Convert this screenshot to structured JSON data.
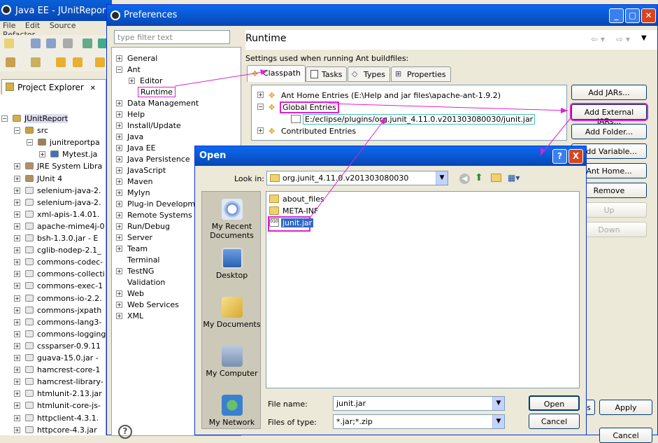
{
  "eclipse": {
    "title": "Java EE - JUnitReport",
    "menu": [
      "File",
      "Edit",
      "Source",
      "Refactor"
    ],
    "project_explorer": {
      "tab_label": "Project Explorer",
      "items": [
        {
          "label": "JUnitReport",
          "depth": 0,
          "icon": "project-icon"
        },
        {
          "label": "src",
          "depth": 1,
          "icon": "source-folder-icon"
        },
        {
          "label": "junitreportpa",
          "depth": 2,
          "icon": "package-icon"
        },
        {
          "label": "Mytest.ja",
          "depth": 3,
          "icon": "java-file-icon"
        },
        {
          "label": "JRE System Libra",
          "depth": 1,
          "icon": "library-icon"
        },
        {
          "label": "JUnit 4",
          "depth": 1,
          "icon": "library-icon"
        },
        {
          "label": "selenium-java-2.",
          "depth": 1,
          "icon": "jar-icon"
        },
        {
          "label": "selenium-java-2.",
          "depth": 1,
          "icon": "jar-icon"
        },
        {
          "label": "xml-apis-1.4.01.",
          "depth": 1,
          "icon": "jar-icon"
        },
        {
          "label": "apache-mime4j-0",
          "depth": 1,
          "icon": "jar-icon"
        },
        {
          "label": "bsh-1.3.0.jar - E",
          "depth": 1,
          "icon": "jar-icon"
        },
        {
          "label": "cglib-nodep-2.1_",
          "depth": 1,
          "icon": "jar-icon"
        },
        {
          "label": "commons-codec-",
          "depth": 1,
          "icon": "jar-icon"
        },
        {
          "label": "commons-collecti",
          "depth": 1,
          "icon": "jar-icon"
        },
        {
          "label": "commons-exec-1",
          "depth": 1,
          "icon": "jar-icon"
        },
        {
          "label": "commons-io-2.2.",
          "depth": 1,
          "icon": "jar-icon"
        },
        {
          "label": "commons-jxpath",
          "depth": 1,
          "icon": "jar-icon"
        },
        {
          "label": "commons-lang3-",
          "depth": 1,
          "icon": "jar-icon"
        },
        {
          "label": "commons-logging",
          "depth": 1,
          "icon": "jar-icon"
        },
        {
          "label": "cssparser-0.9.11",
          "depth": 1,
          "icon": "jar-icon"
        },
        {
          "label": "guava-15.0.jar -",
          "depth": 1,
          "icon": "jar-icon"
        },
        {
          "label": "hamcrest-core-1",
          "depth": 1,
          "icon": "jar-icon"
        },
        {
          "label": "hamcrest-library-",
          "depth": 1,
          "icon": "jar-icon"
        },
        {
          "label": "htmlunit-2.13.jar",
          "depth": 1,
          "icon": "jar-icon"
        },
        {
          "label": "htmlunit-core-js-",
          "depth": 1,
          "icon": "jar-icon"
        },
        {
          "label": "httpclient-4.3.1.",
          "depth": 1,
          "icon": "jar-icon"
        },
        {
          "label": "httpcore-4.3.jar",
          "depth": 1,
          "icon": "jar-icon"
        }
      ]
    }
  },
  "preferences": {
    "title": "Preferences",
    "filter_placeholder": "type filter text",
    "tree": [
      {
        "label": "General",
        "depth": 0,
        "expander": "+"
      },
      {
        "label": "Ant",
        "depth": 0,
        "expander": "-"
      },
      {
        "label": "Editor",
        "depth": 1,
        "expander": "+"
      },
      {
        "label": "Runtime",
        "depth": 1,
        "expander": "",
        "selected": true
      },
      {
        "label": "Data Management",
        "depth": 0,
        "expander": "+"
      },
      {
        "label": "Help",
        "depth": 0,
        "expander": "+"
      },
      {
        "label": "Install/Update",
        "depth": 0,
        "expander": "+"
      },
      {
        "label": "Java",
        "depth": 0,
        "expander": "+"
      },
      {
        "label": "Java EE",
        "depth": 0,
        "expander": "+"
      },
      {
        "label": "Java Persistence",
        "depth": 0,
        "expander": "+"
      },
      {
        "label": "JavaScript",
        "depth": 0,
        "expander": "+"
      },
      {
        "label": "Maven",
        "depth": 0,
        "expander": "+"
      },
      {
        "label": "Mylyn",
        "depth": 0,
        "expander": "+"
      },
      {
        "label": "Plug-in Development",
        "depth": 0,
        "expander": "+"
      },
      {
        "label": "Remote Systems",
        "depth": 0,
        "expander": "+"
      },
      {
        "label": "Run/Debug",
        "depth": 0,
        "expander": "+"
      },
      {
        "label": "Server",
        "depth": 0,
        "expander": "+"
      },
      {
        "label": "Team",
        "depth": 0,
        "expander": "+"
      },
      {
        "label": "Terminal",
        "depth": 0,
        "expander": ""
      },
      {
        "label": "TestNG",
        "depth": 0,
        "expander": "+"
      },
      {
        "label": "Validation",
        "depth": 0,
        "expander": ""
      },
      {
        "label": "Web",
        "depth": 0,
        "expander": "+"
      },
      {
        "label": "Web Services",
        "depth": 0,
        "expander": "+"
      },
      {
        "label": "XML",
        "depth": 0,
        "expander": "+"
      }
    ],
    "page_title": "Runtime",
    "description": "Settings used when running Ant buildfiles:",
    "tabs": [
      "Classpath",
      "Tasks",
      "Types",
      "Properties"
    ],
    "classpath_entries": [
      {
        "label": "Ant Home Entries (E:\\Help and jar files\\apache-ant-1.9.2)",
        "depth": 0,
        "expander": "+"
      },
      {
        "label": "Global Entries",
        "depth": 0,
        "expander": "-"
      },
      {
        "label": "E:/eclipse/plugins/org.junit_4.11.0.v201303080030/junit.jar",
        "depth": 1,
        "expander": ""
      },
      {
        "label": "Contributed Entries",
        "depth": 0,
        "expander": "+"
      }
    ],
    "buttons": {
      "add_jars": "Add JARs...",
      "add_external_jars": "Add External JARs...",
      "add_folder": "Add Folder...",
      "add_variable": "Add Variable...",
      "ant_home": "Ant Home...",
      "remove": "Remove",
      "up": "Up",
      "down": "Down",
      "restore": "s",
      "apply": "Apply",
      "cancel": "Cancel"
    }
  },
  "open_dialog": {
    "title": "Open",
    "look_in_label": "Look in:",
    "look_in_value": "org.junit_4.11.0.v201303080030",
    "places": [
      "My Recent Documents",
      "Desktop",
      "My Documents",
      "My Computer",
      "My Network"
    ],
    "files": [
      {
        "name": "about_files",
        "type": "folder"
      },
      {
        "name": "META-INF",
        "type": "folder"
      },
      {
        "name": "junit.jar",
        "type": "jar",
        "selected": true
      }
    ],
    "file_name_label": "File name:",
    "file_name_value": "junit.jar",
    "file_type_label": "Files of type:",
    "file_type_value": "*.jar;*.zip",
    "open_button": "Open",
    "cancel_button": "Cancel",
    "help_button": "?",
    "close_button": "X"
  },
  "colors": {
    "highlight": "#e020d0",
    "title_bar": "#0a5fd8",
    "selection": "#316ac5"
  }
}
